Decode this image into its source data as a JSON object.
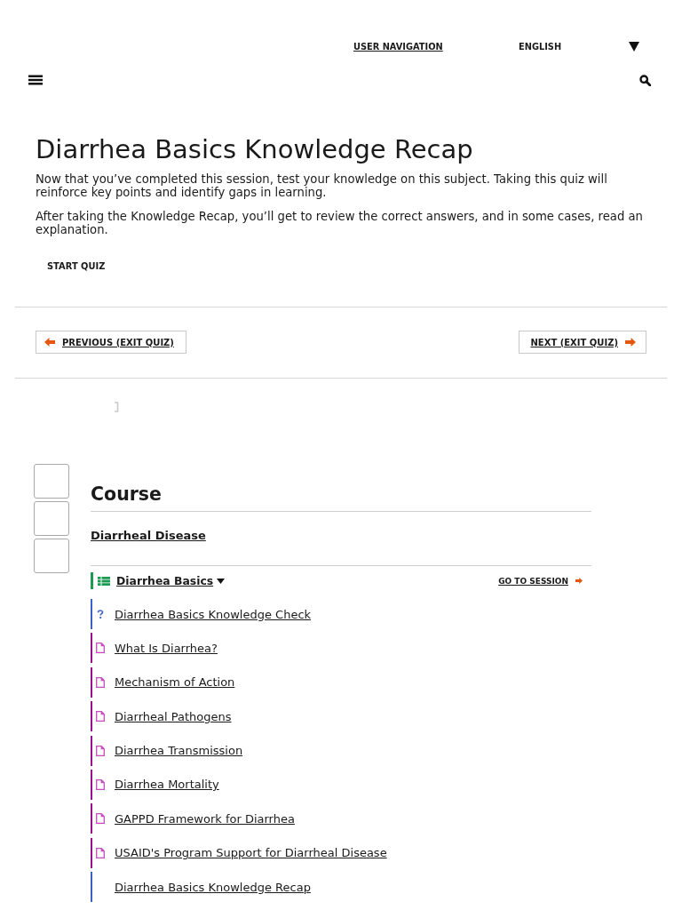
{
  "top_bar": {
    "user_navigation": "USER NAVIGATION",
    "language": "ENGLISH"
  },
  "intro": {
    "title": "Diarrhea Basics Knowledge Recap",
    "paragraphs": [
      "Now that you’ve completed this session, test your knowledge on this subject. Taking this quiz will reinforce key points and identify gaps in learning.",
      "After taking the Knowledge Recap, you’ll get to review the correct answers, and in some cases, read an explanation."
    ],
    "start_button": "START QUIZ"
  },
  "pager": {
    "previous": "PREVIOUS (EXIT QUIZ)",
    "next": "NEXT (EXIT QUIZ)"
  },
  "course": {
    "heading": "Course",
    "name": "Diarrheal Disease",
    "session": {
      "title": "Diarrhea Basics",
      "expanded": true,
      "go_link": "GO TO SESSION",
      "lessons": [
        {
          "kind": "check",
          "title": "Diarrhea Basics Knowledge Check"
        },
        {
          "kind": "page",
          "title": "What Is Diarrhea?"
        },
        {
          "kind": "page",
          "title": "Mechanism of Action"
        },
        {
          "kind": "page",
          "title": "Diarrheal Pathogens"
        },
        {
          "kind": "page",
          "title": "Diarrhea Transmission"
        },
        {
          "kind": "page",
          "title": "Diarrhea Mortality"
        },
        {
          "kind": "page",
          "title": "GAPPD Framework for Diarrhea"
        },
        {
          "kind": "page",
          "title": "USAID's Program Support for Diarrheal Disease"
        },
        {
          "kind": "recap",
          "title": "Diarrhea Basics Knowledge Recap"
        }
      ]
    }
  }
}
